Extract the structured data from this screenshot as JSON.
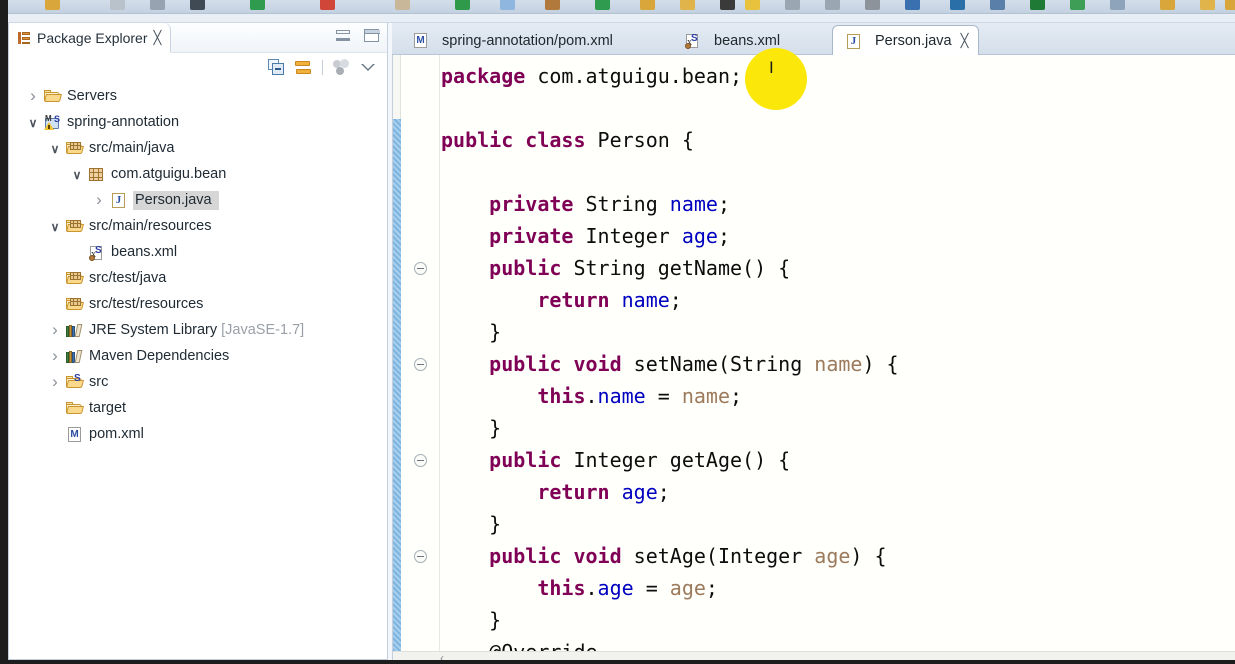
{
  "toolbar": {
    "icons": [
      "folder-icon",
      "table-icon",
      "table-alt-icon",
      "filter-icon",
      "run-icon",
      "stop-icon",
      "minus-icon",
      "debug-run-icon",
      "note-icon",
      "package-icon",
      "run-green-icon",
      "open-folder-icon",
      "yellow-folder-icon",
      "pencil-icon",
      "highlight-icon",
      "list-icon",
      "columns-icon",
      "triangle-down-icon",
      "blue-arrow-icon",
      "import-icon",
      "search-icon",
      "green-shape-icon",
      "refresh-icon",
      "window-icon",
      "ruler-icon",
      "flag-icon",
      "flag2-icon"
    ]
  },
  "explorer": {
    "title": "Package Explorer",
    "close_glyph": "╳",
    "view_icon": "package-explorer-icon",
    "toolbar": [
      {
        "name": "collapse-all-button",
        "label": "Collapse All"
      },
      {
        "name": "link-with-editor-button",
        "label": "Link with Editor"
      },
      {
        "name": "focus-on-active-task-button",
        "label": "Focus on Active Task"
      },
      {
        "name": "view-menu-button",
        "label": "View Menu"
      }
    ],
    "minimize_label": "Minimize",
    "maximize_label": "Maximize",
    "tree": [
      {
        "label": "Servers",
        "suffix": "",
        "indent": 0,
        "twisty": "closed",
        "icon": "folder-icon",
        "selected": false
      },
      {
        "label": "spring-annotation",
        "suffix": "",
        "indent": 0,
        "twisty": "open",
        "icon": "maven-spring-project-icon",
        "selected": false
      },
      {
        "label": "src/main/java",
        "suffix": "",
        "indent": 1,
        "twisty": "open",
        "icon": "source-folder-icon",
        "selected": false
      },
      {
        "label": "com.atguigu.bean",
        "suffix": "",
        "indent": 2,
        "twisty": "open",
        "icon": "package-icon",
        "selected": false
      },
      {
        "label": "Person.java",
        "suffix": "",
        "indent": 3,
        "twisty": "closed",
        "icon": "java-file-icon",
        "selected": true
      },
      {
        "label": "src/main/resources",
        "suffix": "",
        "indent": 1,
        "twisty": "open",
        "icon": "source-folder-icon",
        "selected": false
      },
      {
        "label": "beans.xml",
        "suffix": "",
        "indent": 2,
        "twisty": "none",
        "icon": "spring-xml-file-icon",
        "selected": false
      },
      {
        "label": "src/test/java",
        "suffix": "",
        "indent": 1,
        "twisty": "none",
        "icon": "source-folder-icon",
        "selected": false
      },
      {
        "label": "src/test/resources",
        "suffix": "",
        "indent": 1,
        "twisty": "none",
        "icon": "source-folder-icon",
        "selected": false
      },
      {
        "label": "JRE System Library",
        "suffix": " [JavaSE-1.7]",
        "indent": 1,
        "twisty": "closed",
        "icon": "library-icon",
        "selected": false
      },
      {
        "label": "Maven Dependencies",
        "suffix": "",
        "indent": 1,
        "twisty": "closed",
        "icon": "library-icon",
        "selected": false
      },
      {
        "label": "src",
        "suffix": "",
        "indent": 1,
        "twisty": "closed",
        "icon": "source-folder-spring-icon",
        "selected": false
      },
      {
        "label": "target",
        "suffix": "",
        "indent": 1,
        "twisty": "none",
        "icon": "folder-icon",
        "selected": false
      },
      {
        "label": "pom.xml",
        "suffix": "",
        "indent": 1,
        "twisty": "none",
        "icon": "maven-pom-icon",
        "selected": false
      }
    ]
  },
  "editor": {
    "tabs": [
      {
        "label": "spring-annotation/pom.xml",
        "icon": "maven-pom-icon",
        "active": false,
        "closable": false
      },
      {
        "label": "beans.xml",
        "icon": "spring-xml-file-icon",
        "active": false,
        "closable": false
      },
      {
        "label": "Person.java",
        "icon": "java-file-icon",
        "active": true,
        "closable": true,
        "close_glyph": "╳"
      }
    ],
    "scroll_left_glyph": "‹",
    "fold_markers": 4,
    "code_lines": [
      {
        "tokens": [
          {
            "t": "package ",
            "c": "kw"
          },
          {
            "t": "com.atguigu.bean;",
            "c": "pln"
          }
        ]
      },
      {
        "tokens": []
      },
      {
        "tokens": [
          {
            "t": "public class ",
            "c": "kw"
          },
          {
            "t": "Person {",
            "c": "pln"
          }
        ]
      },
      {
        "tokens": []
      },
      {
        "tokens": [
          {
            "t": "    private ",
            "c": "kw"
          },
          {
            "t": "String ",
            "c": "pln"
          },
          {
            "t": "name",
            "c": "fld"
          },
          {
            "t": ";",
            "c": "pln"
          }
        ]
      },
      {
        "tokens": [
          {
            "t": "    private ",
            "c": "kw"
          },
          {
            "t": "Integer ",
            "c": "pln"
          },
          {
            "t": "age",
            "c": "fld"
          },
          {
            "t": ";",
            "c": "pln"
          }
        ]
      },
      {
        "tokens": [
          {
            "t": "    public ",
            "c": "kw"
          },
          {
            "t": "String getName() {",
            "c": "pln"
          }
        ]
      },
      {
        "tokens": [
          {
            "t": "        return ",
            "c": "kw"
          },
          {
            "t": "name",
            "c": "fld"
          },
          {
            "t": ";",
            "c": "pln"
          }
        ]
      },
      {
        "tokens": [
          {
            "t": "    }",
            "c": "pln"
          }
        ]
      },
      {
        "tokens": [
          {
            "t": "    public void ",
            "c": "kw"
          },
          {
            "t": "setName(String ",
            "c": "pln"
          },
          {
            "t": "name",
            "c": "par"
          },
          {
            "t": ") {",
            "c": "pln"
          }
        ]
      },
      {
        "tokens": [
          {
            "t": "        this",
            "c": "kw"
          },
          {
            "t": ".",
            "c": "pln"
          },
          {
            "t": "name",
            "c": "fld"
          },
          {
            "t": " = ",
            "c": "pln"
          },
          {
            "t": "name",
            "c": "par"
          },
          {
            "t": ";",
            "c": "pln"
          }
        ]
      },
      {
        "tokens": [
          {
            "t": "    }",
            "c": "pln"
          }
        ]
      },
      {
        "tokens": [
          {
            "t": "    public ",
            "c": "kw"
          },
          {
            "t": "Integer getAge() {",
            "c": "pln"
          }
        ]
      },
      {
        "tokens": [
          {
            "t": "        return ",
            "c": "kw"
          },
          {
            "t": "age",
            "c": "fld"
          },
          {
            "t": ";",
            "c": "pln"
          }
        ]
      },
      {
        "tokens": [
          {
            "t": "    }",
            "c": "pln"
          }
        ]
      },
      {
        "tokens": [
          {
            "t": "    public void ",
            "c": "kw"
          },
          {
            "t": "setAge(Integer ",
            "c": "pln"
          },
          {
            "t": "age",
            "c": "par"
          },
          {
            "t": ") {",
            "c": "pln"
          }
        ]
      },
      {
        "tokens": [
          {
            "t": "        this",
            "c": "kw"
          },
          {
            "t": ".",
            "c": "pln"
          },
          {
            "t": "age",
            "c": "fld"
          },
          {
            "t": " = ",
            "c": "pln"
          },
          {
            "t": "age",
            "c": "par"
          },
          {
            "t": ";",
            "c": "pln"
          }
        ]
      },
      {
        "tokens": [
          {
            "t": "    }",
            "c": "pln"
          }
        ]
      },
      {
        "tokens": [
          {
            "t": "    @Override",
            "c": "pln"
          }
        ]
      }
    ]
  },
  "cursor": {
    "name": "text-cursor",
    "glyph": "I"
  },
  "colors": {
    "keyword": "#7f0055",
    "field": "#0000c0",
    "parameter": "#9c7a5c",
    "plain": "#0d0d0d",
    "selection": "#d6d6d6",
    "highlight": "#fbe80a",
    "tab_active_bg": "#ffffff"
  }
}
